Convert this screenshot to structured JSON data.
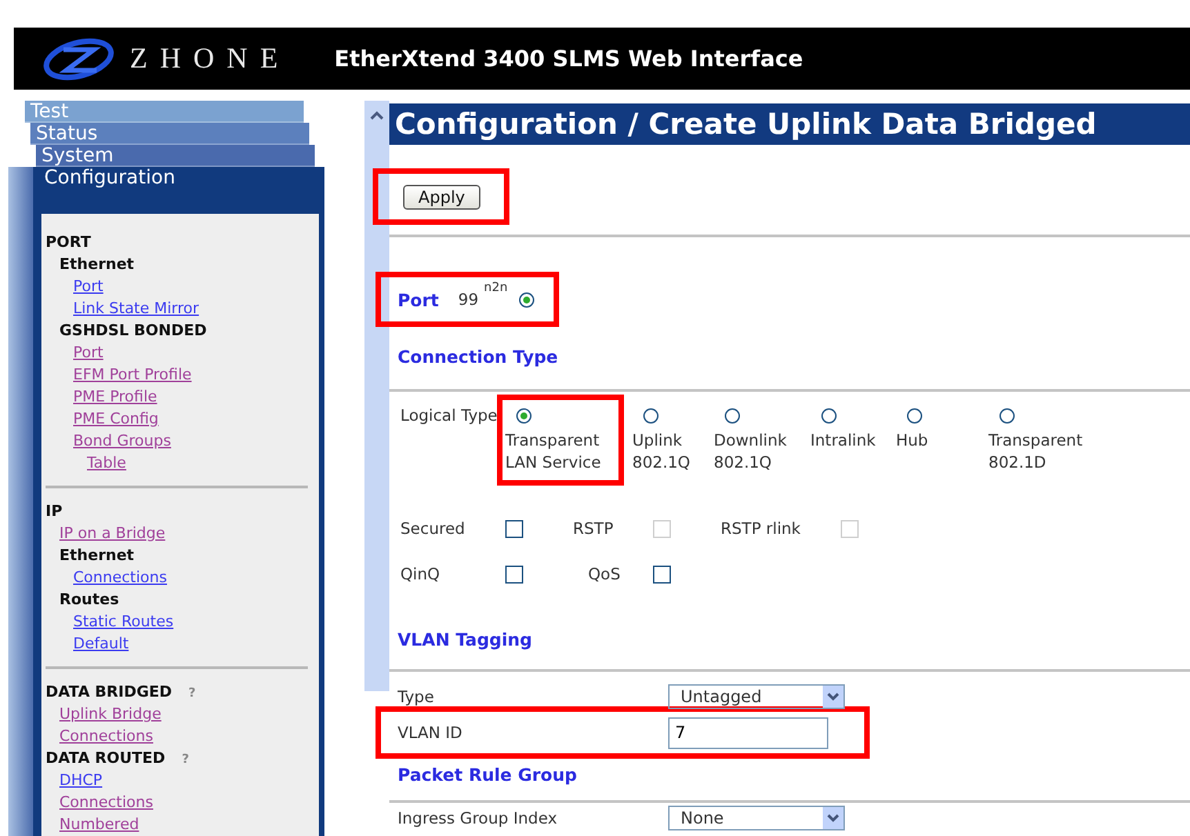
{
  "header": {
    "logo_text": "ZHONE",
    "title": "EtherXtend 3400 SLMS Web Interface"
  },
  "sidebar": {
    "tabs": [
      {
        "label": "Test",
        "selected": false
      },
      {
        "label": "Status",
        "selected": false
      },
      {
        "label": "System",
        "selected": false
      },
      {
        "label": "Configuration",
        "selected": true
      }
    ],
    "sections": [
      {
        "items": [
          {
            "label": "PORT",
            "kind": "heading",
            "children": [
              {
                "label": "Ethernet",
                "kind": "heading",
                "children": [
                  {
                    "label": "Port",
                    "kind": "link",
                    "visited": false
                  },
                  {
                    "label": "Link State Mirror",
                    "kind": "link",
                    "visited": false
                  }
                ]
              },
              {
                "label": "GSHDSL BONDED",
                "kind": "heading",
                "children": [
                  {
                    "label": "Port",
                    "kind": "link",
                    "visited": true
                  },
                  {
                    "label": "EFM Port Profile",
                    "kind": "link",
                    "visited": true
                  },
                  {
                    "label": "PME Profile",
                    "kind": "link",
                    "visited": true
                  },
                  {
                    "label": "PME Config",
                    "kind": "link",
                    "visited": true
                  },
                  {
                    "label": "Bond Groups",
                    "kind": "link",
                    "visited": true,
                    "children": [
                      {
                        "label": "Table",
                        "kind": "link",
                        "visited": true
                      }
                    ]
                  }
                ]
              }
            ]
          }
        ]
      },
      {
        "items": [
          {
            "label": "IP",
            "kind": "heading",
            "children": [
              {
                "label": "IP on a Bridge",
                "kind": "link",
                "visited": true
              },
              {
                "label": "Ethernet",
                "kind": "heading",
                "children": [
                  {
                    "label": "Connections",
                    "kind": "link",
                    "visited": false
                  }
                ]
              },
              {
                "label": "Routes",
                "kind": "heading",
                "children": [
                  {
                    "label": "Static Routes",
                    "kind": "link",
                    "visited": false
                  },
                  {
                    "label": "Default",
                    "kind": "link",
                    "visited": false
                  }
                ]
              }
            ]
          }
        ]
      },
      {
        "items": [
          {
            "label": "DATA BRIDGED",
            "kind": "heading",
            "help": "?",
            "children": [
              {
                "label": "Uplink Bridge",
                "kind": "link",
                "visited": true
              },
              {
                "label": "Connections",
                "kind": "link",
                "visited": true
              }
            ]
          },
          {
            "label": "DATA ROUTED",
            "kind": "heading",
            "help": "?",
            "children": [
              {
                "label": "DHCP",
                "kind": "link",
                "visited": false
              },
              {
                "label": "Connections",
                "kind": "link",
                "visited": true
              },
              {
                "label": "Numbered",
                "kind": "link",
                "visited": true
              }
            ]
          }
        ]
      }
    ]
  },
  "page": {
    "title": "Configuration / Create Uplink Data Bridged",
    "apply": {
      "label": "Apply",
      "highlighted": true
    },
    "port": {
      "label": "Port",
      "value": "99",
      "superscript": "n2n",
      "selected": true,
      "highlighted": true
    },
    "connection_type": {
      "title": "Connection Type",
      "logical_type": {
        "label": "Logical Type",
        "options": [
          {
            "label": "Transparent LAN Service",
            "selected": true,
            "highlighted": true
          },
          {
            "label": "Uplink 802.1Q",
            "selected": false,
            "highlighted": false
          },
          {
            "label": "Downlink 802.1Q",
            "selected": false,
            "highlighted": false
          },
          {
            "label": "Intralink",
            "selected": false,
            "highlighted": false
          },
          {
            "label": "Hub",
            "selected": false,
            "highlighted": false
          },
          {
            "label": "Transparent 802.1D",
            "selected": false,
            "highlighted": false
          }
        ]
      },
      "checkbox_rows": [
        {
          "items": [
            {
              "label": "Secured",
              "checked": false,
              "disabled": false
            },
            {
              "label": "RSTP",
              "checked": false,
              "disabled": true
            },
            {
              "label": "RSTP rlink",
              "checked": false,
              "disabled": true
            }
          ]
        },
        {
          "items": [
            {
              "label": "QinQ",
              "checked": false,
              "disabled": false
            },
            {
              "label": "QoS",
              "checked": false,
              "disabled": false
            }
          ]
        }
      ]
    },
    "vlan_tagging": {
      "title": "VLAN Tagging",
      "type": {
        "label": "Type",
        "value": "Untagged"
      },
      "vlan_id": {
        "label": "VLAN ID",
        "value": "7",
        "highlighted": true
      }
    },
    "packet_rule_group": {
      "title": "Packet Rule Group",
      "ingress_group_index": {
        "label": "Ingress Group Index",
        "value": "None"
      }
    }
  }
}
